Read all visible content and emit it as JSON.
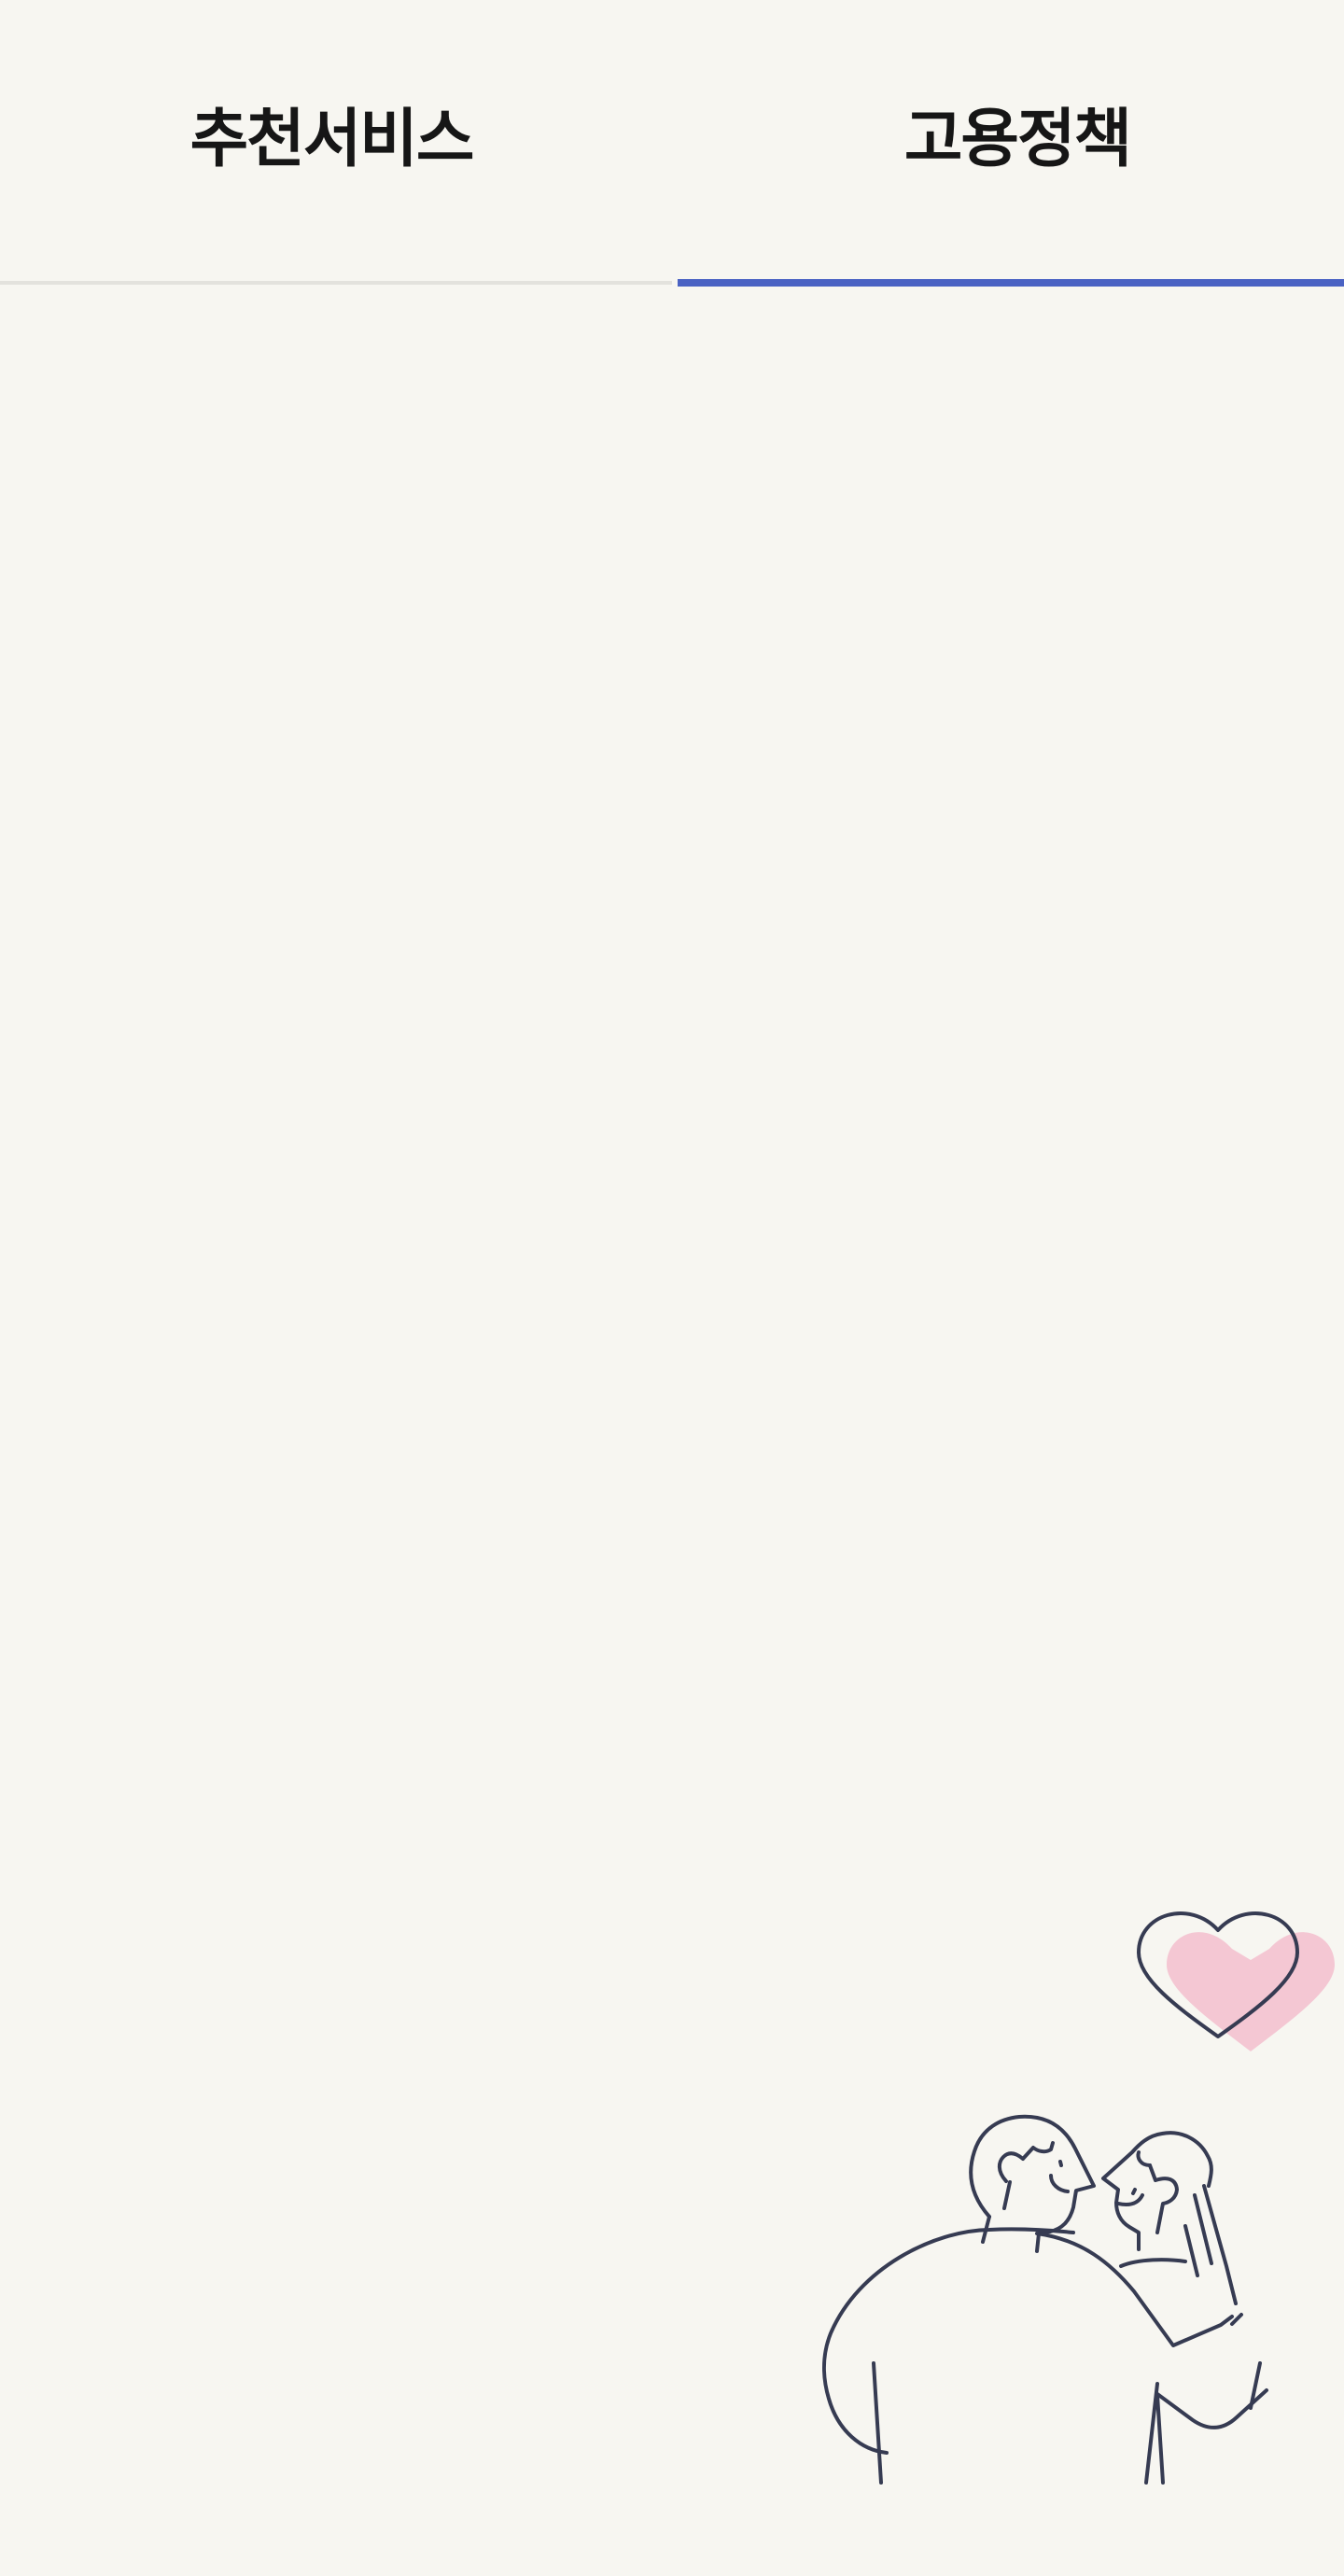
{
  "tabs": [
    {
      "label": "추천서비스",
      "active": false
    },
    {
      "label": "고용정책",
      "active": true
    }
  ],
  "colors": {
    "background": "#f7f6f1",
    "active_underline": "#4a62c3",
    "inactive_underline": "#e3e2dd",
    "tab_text": "#161616",
    "illustration_stroke": "#363b52",
    "heart_fill": "#f4c7d3"
  },
  "illustration": {
    "icon": "couple-hug-heart-illustration"
  }
}
